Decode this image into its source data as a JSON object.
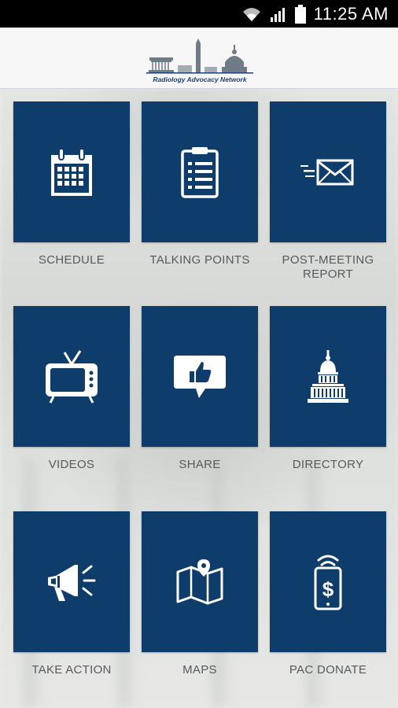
{
  "status_bar": {
    "time": "11:25 AM"
  },
  "header": {
    "logo_text": "Radiology Advocacy Network"
  },
  "tiles": [
    {
      "label": "SCHEDULE",
      "icon": "calendar-icon"
    },
    {
      "label": "TALKING POINTS",
      "icon": "clipboard-icon"
    },
    {
      "label": "POST-MEETING\nREPORT",
      "icon": "envelope-icon"
    },
    {
      "label": "VIDEOS",
      "icon": "tv-icon"
    },
    {
      "label": "SHARE",
      "icon": "thumbs-up-icon"
    },
    {
      "label": "DIRECTORY",
      "icon": "capitol-icon"
    },
    {
      "label": "TAKE ACTION",
      "icon": "megaphone-icon"
    },
    {
      "label": "MAPS",
      "icon": "map-icon"
    },
    {
      "label": "PAC DONATE",
      "icon": "phone-dollar-icon"
    }
  ],
  "colors": {
    "tile": "#0f3d6b",
    "label": "#555a5d",
    "statusbar": "#000000"
  }
}
